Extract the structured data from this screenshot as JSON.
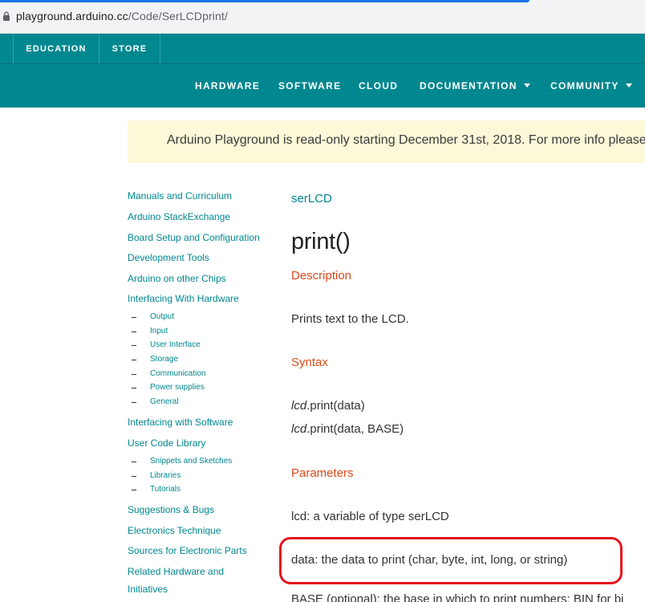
{
  "browser": {
    "url_host": "playground.arduino.cc",
    "url_path": "/Code/SerLCDprint/"
  },
  "topbar": {
    "education": "EDUCATION",
    "store": "STORE"
  },
  "mainnav": {
    "hardware": "HARDWARE",
    "software": "SOFTWARE",
    "cloud": "CLOUD",
    "documentation": "DOCUMENTATION",
    "community": "COMMUNITY"
  },
  "notice": {
    "text": "Arduino Playground is read-only starting December 31st, 2018. For more info please l"
  },
  "sidebar": {
    "items": [
      "Manuals and Curriculum",
      "Arduino StackExchange",
      "Board Setup and Configuration",
      "Development Tools",
      "Arduino on other Chips",
      "Interfacing With Hardware"
    ],
    "hardware_sub": [
      "Output",
      "Input",
      "User Interface",
      "Storage",
      "Communication",
      "Power supplies",
      "General"
    ],
    "items2": [
      "Interfacing with Software",
      "User Code Library"
    ],
    "library_sub": [
      "Snippets and Sketches",
      "Libraries",
      "Tutorials"
    ],
    "items3": [
      "Suggestions & Bugs",
      "Electronics Technique",
      "Sources for Electronic Parts",
      "Related Hardware and",
      "Initiatives"
    ]
  },
  "content": {
    "breadcrumb": "serLCD",
    "title": "print()",
    "description_head": "Description",
    "description": "Prints text to the LCD.",
    "syntax_head": "Syntax",
    "syntax1_obj": "lcd",
    "syntax1_rest": ".print(data)",
    "syntax2_obj": "lcd",
    "syntax2_rest": ".print(data, BASE)",
    "parameters_head": "Parameters",
    "param_lcd": "lcd: a variable of type serLCD",
    "param_data": "data: the data to print (char, byte, int, long, or string)",
    "param_base_partial": "BASE (optional): the base in which to print numbers: BIN for bi"
  },
  "colors": {
    "teal": "#00878f",
    "orange_heading": "#d84a1b",
    "notice_bg": "#fcf8d8",
    "highlight_red": "#e3141b"
  }
}
